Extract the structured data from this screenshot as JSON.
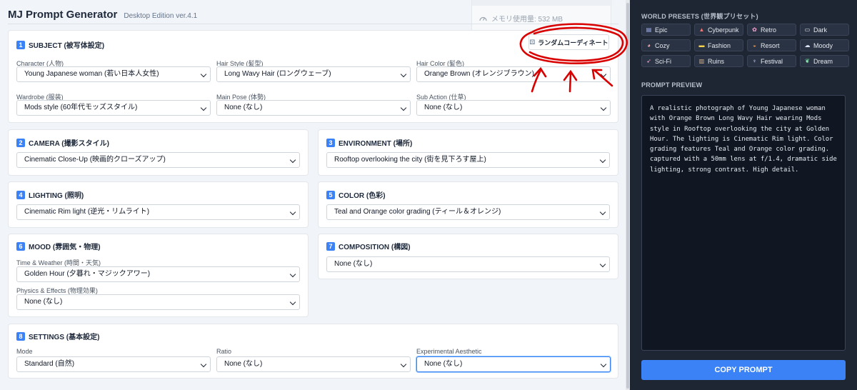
{
  "header": {
    "title": "MJ Prompt Generator",
    "version": "Desktop Edition ver.4.1"
  },
  "memory": {
    "label": "メモリ使用量: 532 MB"
  },
  "random_button": {
    "label": "ランダムコーディネート"
  },
  "subject": {
    "number": "1",
    "title": "SUBJECT (被写体設定)",
    "fields": [
      {
        "label": "Character (人物)",
        "value": "Young Japanese woman (若い日本人女性)"
      },
      {
        "label": "Hair Style (髪型)",
        "value": "Long Wavy Hair (ロングウェーブ)"
      },
      {
        "label": "Hair Color (髪色)",
        "value": "Orange Brown (オレンジブラウン)"
      },
      {
        "label": "Wardrobe (服装)",
        "value": "Mods style (60年代モッズスタイル)"
      },
      {
        "label": "Main Pose (体勢)",
        "value": "None (なし)"
      },
      {
        "label": "Sub Action (仕草)",
        "value": "None (なし)"
      }
    ]
  },
  "camera": {
    "number": "2",
    "title": "CAMERA (撮影スタイル)",
    "value": "Cinematic Close-Up (映画的クローズアップ)"
  },
  "environment": {
    "number": "3",
    "title": "ENVIRONMENT (場所)",
    "value": "Rooftop overlooking the city (街を見下ろす屋上)"
  },
  "lighting": {
    "number": "4",
    "title": "LIGHTING (照明)",
    "value": "Cinematic Rim light (逆光・リムライト)"
  },
  "color": {
    "number": "5",
    "title": "COLOR (色彩)",
    "value": "Teal and Orange color grading (ティール＆オレンジ)"
  },
  "mood": {
    "number": "6",
    "title": "MOOD (雰囲気・物理)",
    "fields": [
      {
        "label": "Time & Weather (時間・天気)",
        "value": "Golden Hour (夕暮れ・マジックアワー)"
      },
      {
        "label": "Physics & Effects (物理効果)",
        "value": "None (なし)"
      }
    ]
  },
  "composition": {
    "number": "7",
    "title": "COMPOSITION (構図)",
    "value": "None (なし)"
  },
  "settings": {
    "number": "8",
    "title": "SETTINGS (基本設定)",
    "fields": [
      {
        "label": "Mode",
        "value": "Standard (自然)"
      },
      {
        "label": "Ratio",
        "value": "None (なし)"
      },
      {
        "label": "Experimental Aesthetic",
        "value": "None (なし)"
      }
    ]
  },
  "sidebar": {
    "presets_title": "WORLD PRESETS (世界観プリセット)",
    "presets": [
      {
        "icon": "scroll-icon",
        "glyph": "▤",
        "color": "#a5b4fc",
        "label": "Epic"
      },
      {
        "icon": "tower-icon",
        "glyph": "▲",
        "color": "#f87171",
        "label": "Cyberpunk"
      },
      {
        "icon": "blossom-icon",
        "glyph": "✿",
        "color": "#f9a8d4",
        "label": "Retro"
      },
      {
        "icon": "book-icon",
        "glyph": "▭",
        "color": "#e5e7eb",
        "label": "Dark"
      },
      {
        "icon": "cup-icon",
        "glyph": "◕",
        "color": "#fca5a5",
        "label": "Cozy"
      },
      {
        "icon": "monitor-icon",
        "glyph": "▬",
        "color": "#fcd34d",
        "label": "Fashion"
      },
      {
        "icon": "beach-icon",
        "glyph": "◒",
        "color": "#fb923c",
        "label": "Resort"
      },
      {
        "icon": "cloud-icon",
        "glyph": "☁",
        "color": "#e0e7ff",
        "label": "Moody"
      },
      {
        "icon": "rocket-icon",
        "glyph": "➶",
        "color": "#f9a8d4",
        "label": "Sci-Fi"
      },
      {
        "icon": "ruins-icon",
        "glyph": "▥",
        "color": "#d6b38a",
        "label": "Ruins"
      },
      {
        "icon": "lantern-icon",
        "glyph": "♆",
        "color": "#c7d2fe",
        "label": "Festival"
      },
      {
        "icon": "leaf-icon",
        "glyph": "❦",
        "color": "#86efac",
        "label": "Dream"
      }
    ],
    "preview_title": "PROMPT PREVIEW",
    "preview_text": "A realistic photograph of Young Japanese woman with Orange Brown Long Wavy Hair wearing Mods style in Rooftop overlooking the city at Golden Hour. The lighting is Cinematic Rim light. Color grading features Teal and Orange color grading. captured with a 50mm lens at f/1.4, dramatic side lighting, strong contrast. High detail.",
    "copy_label": "COPY PROMPT"
  },
  "colors": {
    "accent": "#3b82f6",
    "sidebar_bg": "#1e2533",
    "annotation": "#d90000"
  }
}
